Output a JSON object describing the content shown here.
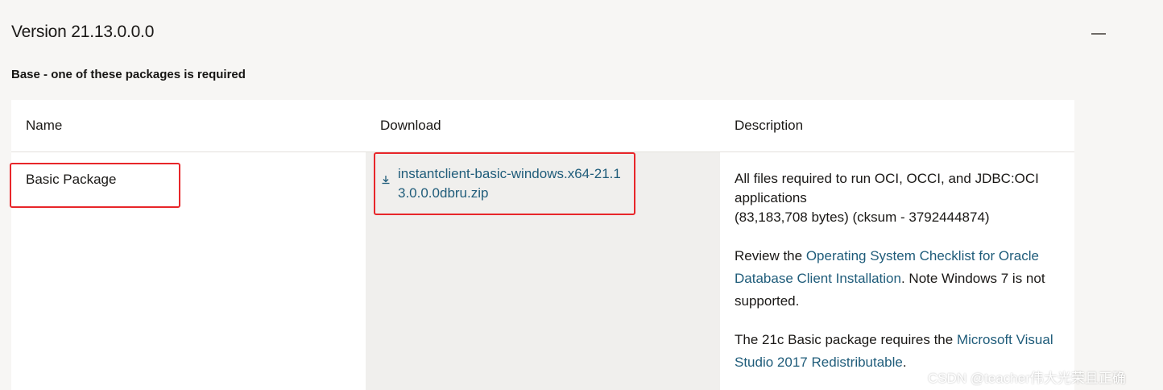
{
  "version_title": "Version 21.13.0.0.0",
  "collapse_icon": "minus-icon",
  "section_label": "Base - one of these packages is required",
  "table": {
    "headers": [
      "Name",
      "Download",
      "Description"
    ],
    "rows": [
      {
        "name": "Basic Package",
        "download_icon": "download-icon",
        "download_label": "instantclient-basic-windows.x64-21.13.0.0.0dbru.zip",
        "description": {
          "line1": "All files required to run OCI, OCCI, and JDBC:OCI applications",
          "line2": "(83,183,708 bytes) (cksum - 3792444874)",
          "review_prefix": "Review the ",
          "review_link": "Operating System Checklist for Oracle Database Client Installation",
          "review_suffix": ". Note Windows 7 is not supported.",
          "req_prefix": "The 21c Basic package requires the ",
          "req_link": "Microsoft Visual Studio 2017 Redistributable",
          "req_suffix": "."
        }
      }
    ]
  },
  "watermark": "CSDN @teacher伟大光荣且正确",
  "colors": {
    "link": "#1f5c7a",
    "highlight": "#e8262a",
    "page_bg": "#f7f6f4",
    "download_col_bg": "#f0efed"
  }
}
